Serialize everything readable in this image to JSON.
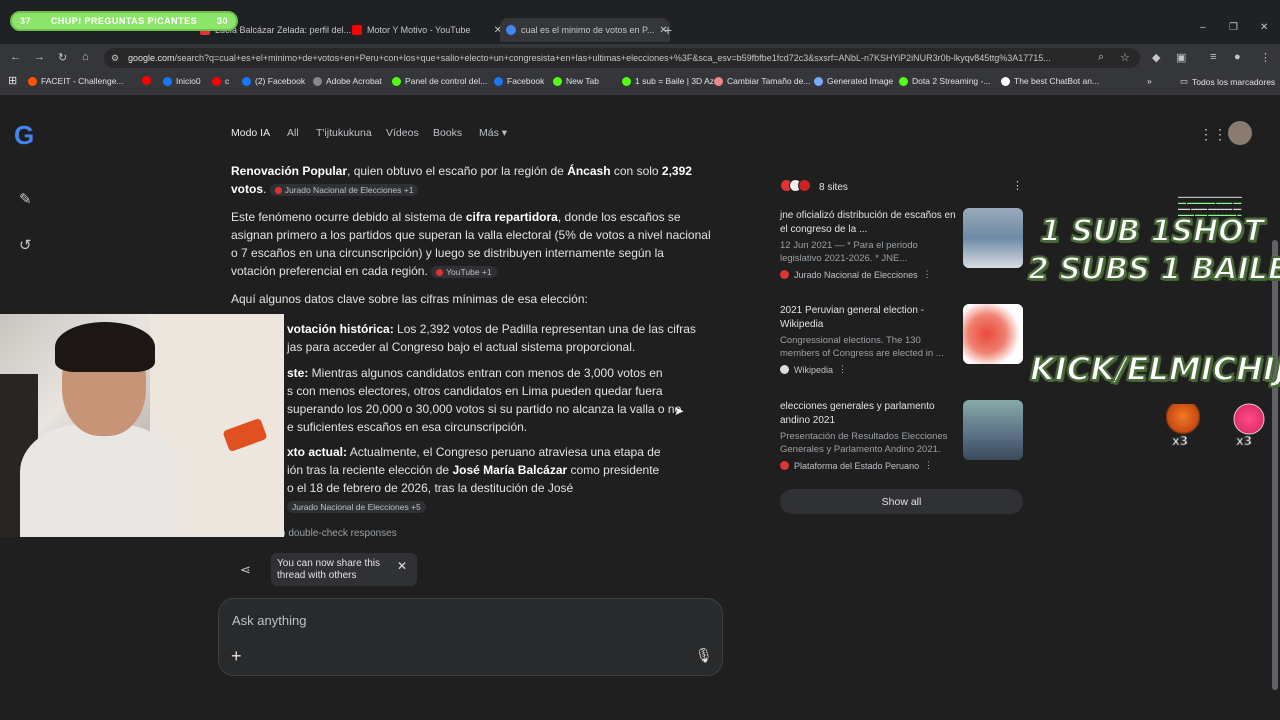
{
  "stream_alert": {
    "label": "CHUPI PREGUNTAS PICANTES",
    "left": "37",
    "right": "30"
  },
  "tabs": [
    {
      "title": "Lucía Balcázar Zelada: perfil del...",
      "color": "#d33"
    },
    {
      "title": "Motor Y Motivo - YouTube",
      "color": "#f00"
    },
    {
      "title": "cual es el minimo de votos en P...",
      "color": "#4285f4"
    }
  ],
  "new_tab": "+",
  "window_controls": {
    "minimize": "–",
    "maximize": "❐",
    "close": "✕"
  },
  "address": {
    "host": "google.com",
    "path": "/search?q=cual+es+el+minimo+de+votos+en+Peru+con+los+que+salio+electo+un+congresista+en+las+ultimas+elecciones+%3F&sca_esv=b59fbfbe1fcd72c3&sxsrf=ANbL-n7KSHYiP2iNUR3r0b-lkyqv845ttg%3A17715..."
  },
  "bookmarks": [
    {
      "label": "FACEIT - Challenge...",
      "color": "#f50"
    },
    {
      "label": "",
      "color": "#f00"
    },
    {
      "label": "Inicio0",
      "color": "#1877f2"
    },
    {
      "label": "c",
      "color": "#f00"
    },
    {
      "label": "(2) Facebook",
      "color": "#1877f2"
    },
    {
      "label": "Adobe Acrobat",
      "color": "#888"
    },
    {
      "label": "Panel de control del...",
      "color": "#53fc18"
    },
    {
      "label": "Facebook",
      "color": "#1877f2"
    },
    {
      "label": "New Tab",
      "color": "#53fc18"
    },
    {
      "label": "1 sub = Baile | 3D Az...",
      "color": "#53fc18"
    },
    {
      "label": "Cambiar Tamaño de...",
      "color": "#e88"
    },
    {
      "label": "Generated Image",
      "color": "#7af"
    },
    {
      "label": "Dota 2 Streaming -...",
      "color": "#53fc18"
    },
    {
      "label": "The best ChatBot an...",
      "color": "#fff"
    }
  ],
  "bookmarks_more": "»",
  "bookmarks_folder": "Todos los marcadores",
  "google_logo": "G",
  "search_nav": [
    {
      "label": "Modo IA"
    },
    {
      "label": "All"
    },
    {
      "label": "T'ijtukukuna"
    },
    {
      "label": "Vídeos"
    },
    {
      "label": "Books"
    },
    {
      "label": "Más ▾"
    }
  ],
  "answer": {
    "p1_a": "Renovación Popular",
    "p1_b": ", quien obtuvo el escaño por la región de ",
    "p1_c": "Áncash",
    "p1_d": " con solo ",
    "p1_e": "2,392 votos",
    "p1_f": ".",
    "cite1": "Jurado Nacional de Elecciones +1",
    "p2_a": "Este fenómeno ocurre debido al sistema de ",
    "p2_b": "cifra repartidora",
    "p2_c": ", donde los escaños se asignan primero a los partidos que superan la valla electoral (5% de votos a nivel nacional o 7 escaños en una circunscripción) y luego se distribuyen internamente según la votación preferencial en cada región.",
    "cite2": "YouTube +1",
    "p3": "Aquí algunos datos clave sobre las cifras mínimas de esa elección:",
    "b1_a": "votación histórica:",
    "b1_b": " Los 2,392 votos de Padilla representan una de las cifras",
    "b1_c": "jas para acceder al Congreso bajo el actual sistema proporcional.",
    "b2_a": "ste:",
    "b2_b": " Mientras algunos candidatos entran con menos de 3,000 votos en",
    "b2_c": "s con menos electores, otros candidatos en Lima pueden quedar fuera",
    "b2_d": "superando los 20,000 o 30,000 votos si su partido no alcanza la valla o no",
    "b2_e": "e suficientes escaños en esa circunscripción.",
    "b3_a": "xto actual:",
    "b3_b": " Actualmente, el Congreso peruano atraviesa una etapa de",
    "b3_c": "ión tras la reciente elección de ",
    "b3_d": "José María Balcázar",
    "b3_e": " como presidente",
    "b3_f": "o el 18 de febrero de 2026, tras la destitución de José",
    "cite3": "Jurado Nacional de Elecciones +5",
    "disclaimer": "mistakes, so double-check responses"
  },
  "sources": {
    "count_label": "8 sites",
    "items": [
      {
        "title": "jne oficializó distribución de escaños en el congreso de la ...",
        "desc": "12 Jun 2021 — * Para el periodo legislativo 2021-2026. * JNE...",
        "site": "Jurado Nacional de Elecciones",
        "thumb": "#6d8aa6"
      },
      {
        "title": "2021 Peruvian general election - Wikipedia",
        "desc": "Congressional elections. The 130 members of Congress are elected in ...",
        "site": "Wikipedia",
        "thumb": "#e84a3a"
      },
      {
        "title": "elecciones generales y parlamento andino 2021",
        "desc": "Presentación de Resultados Elecciones Generales y Parlamento Andino 2021.",
        "site": "Plataforma del Estado Peruano",
        "thumb": "#5a6f85"
      }
    ],
    "show_all": "Show all"
  },
  "tooltip": "You can now share this thread with others",
  "ask_placeholder": "Ask anything",
  "overlay": {
    "line1": "1 SUB  1SHOT",
    "line2": "2 SUBS 1 BAILE",
    "line3": "KICK/ELMICHIJ",
    "emote_count1": "x3",
    "emote_count2": "x3"
  }
}
